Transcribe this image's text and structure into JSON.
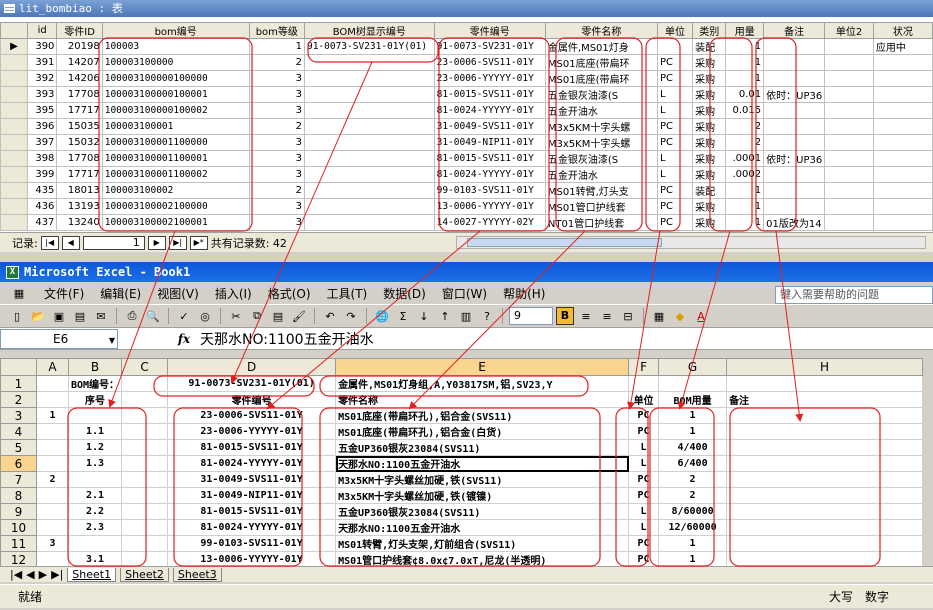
{
  "access": {
    "title": "lit_bombiao : 表",
    "columns": [
      "id",
      "零件ID",
      "bom编号",
      "bom等级",
      "BOM树显示编号",
      "零件编号",
      "零件名称",
      "单位",
      "类别",
      "用量",
      "备注",
      "单位2",
      "状况"
    ],
    "rows": [
      {
        "id": "390",
        "pid": "20198",
        "bom": "100003",
        "level": "1",
        "tree": "91-0073-SV231-01Y(01)",
        "part": "91-0073-SV231-01Y",
        "name": "金属件,MS01灯身",
        "unit": "",
        "cat": "装配",
        "qty": "1",
        "note": "",
        "unit2": "",
        "status": "应用中",
        "current": true
      },
      {
        "id": "391",
        "pid": "14207",
        "bom": "100003100000",
        "level": "2",
        "tree": "",
        "part": "23-0006-SVS11-01Y",
        "name": "MS01底座(带扁环",
        "unit": "PC",
        "cat": "采购",
        "qty": "1",
        "note": "",
        "unit2": "",
        "status": "",
        "current": false
      },
      {
        "id": "392",
        "pid": "14206",
        "bom": "100003100000100000",
        "level": "3",
        "tree": "",
        "part": "23-0006-YYYYY-01Y",
        "name": "MS01底座(带扁环",
        "unit": "PC",
        "cat": "采购",
        "qty": "1",
        "note": "",
        "unit2": "",
        "status": "",
        "current": false
      },
      {
        "id": "393",
        "pid": "17708",
        "bom": "100003100000100001",
        "level": "3",
        "tree": "",
        "part": "81-0015-SVS11-01Y",
        "name": "五金银灰油漆(S",
        "unit": "L",
        "cat": "采购",
        "qty": "0.01",
        "note": "依时：UP36",
        "unit2": "",
        "status": "",
        "current": false
      },
      {
        "id": "395",
        "pid": "17717",
        "bom": "100003100000100002",
        "level": "3",
        "tree": "",
        "part": "81-0024-YYYYY-01Y",
        "name": "五金开油水",
        "unit": "L",
        "cat": "采购",
        "qty": "0.015",
        "note": "",
        "unit2": "",
        "status": "",
        "current": false
      },
      {
        "id": "396",
        "pid": "15035",
        "bom": "100003100001",
        "level": "2",
        "tree": "",
        "part": "31-0049-SVS11-01Y",
        "name": "M3x5KM十字头螺",
        "unit": "PC",
        "cat": "采购",
        "qty": "2",
        "note": "",
        "unit2": "",
        "status": "",
        "current": false
      },
      {
        "id": "397",
        "pid": "15032",
        "bom": "100003100001100000",
        "level": "3",
        "tree": "",
        "part": "31-0049-NIP11-01Y",
        "name": "M3x5KM十字头螺",
        "unit": "PC",
        "cat": "采购",
        "qty": "2",
        "note": "",
        "unit2": "",
        "status": "",
        "current": false
      },
      {
        "id": "398",
        "pid": "17708",
        "bom": "100003100001100001",
        "level": "3",
        "tree": "",
        "part": "81-0015-SVS11-01Y",
        "name": "五金银灰油漆(S",
        "unit": "L",
        "cat": "采购",
        "qty": ".0001",
        "note": "依时：UP36",
        "unit2": "",
        "status": "",
        "current": false
      },
      {
        "id": "399",
        "pid": "17717",
        "bom": "100003100001100002",
        "level": "3",
        "tree": "",
        "part": "81-0024-YYYYY-01Y",
        "name": "五金开油水",
        "unit": "L",
        "cat": "采购",
        "qty": ".0002",
        "note": "",
        "unit2": "",
        "status": "",
        "current": false
      },
      {
        "id": "435",
        "pid": "18013",
        "bom": "100003100002",
        "level": "2",
        "tree": "",
        "part": "99-0103-SVS11-01Y",
        "name": "MS01转臂,灯头支",
        "unit": "PC",
        "cat": "装配",
        "qty": "1",
        "note": "",
        "unit2": "",
        "status": "",
        "current": false
      },
      {
        "id": "436",
        "pid": "13193",
        "bom": "100003100002100000",
        "level": "3",
        "tree": "",
        "part": "13-0006-YYYYY-01Y",
        "name": "MS01管口护线套",
        "unit": "PC",
        "cat": "采购",
        "qty": "1",
        "note": "",
        "unit2": "",
        "status": "",
        "current": false
      },
      {
        "id": "437",
        "pid": "13240",
        "bom": "100003100002100001",
        "level": "3",
        "tree": "",
        "part": "14-0027-YYYYY-02Y",
        "name": "NT01管口护线套",
        "unit": "PC",
        "cat": "采购",
        "qty": "1",
        "note": "01版改为14",
        "unit2": "",
        "status": "",
        "current": false
      }
    ],
    "record_label": "记录:",
    "record_value": "1",
    "record_total": "共有记录数: 42"
  },
  "excel": {
    "title": "Microsoft Excel - Book1",
    "menu": [
      "文件(F)",
      "编辑(E)",
      "视图(V)",
      "插入(I)",
      "格式(O)",
      "工具(T)",
      "数据(D)",
      "窗口(W)",
      "帮助(H)"
    ],
    "help_placeholder": "键入需要帮助的问题",
    "font_size": "9",
    "name_box": "E6",
    "formula": "天那水NO:1100五金开油水",
    "col_headers": [
      "A",
      "B",
      "C",
      "D",
      "E",
      "F",
      "G",
      "H"
    ],
    "rows": [
      {
        "n": "1",
        "a": "",
        "b": "BOM编号：",
        "c": "",
        "d": "91-0073-SV231-01Y(01)",
        "e": "金属件,MS01灯身组,A,Y03817SM,铝,SV23,Y",
        "f": "",
        "g": "",
        "h": ""
      },
      {
        "n": "2",
        "a": "",
        "b": "序号",
        "c": "",
        "d": "零件编号",
        "e": "零件名称",
        "f": "单位",
        "g": "BOM用量",
        "h": "备注"
      },
      {
        "n": "3",
        "a": "1",
        "b": "",
        "c": "",
        "d": "23-0006-SVS11-01Y",
        "e": "MS01底座(带扁环孔),铝合金(SVS11)",
        "f": "PC",
        "g": "1",
        "h": ""
      },
      {
        "n": "4",
        "a": "",
        "b": "1.1",
        "c": "",
        "d": "23-0006-YYYYY-01Y",
        "e": "MS01底座(带扁环孔),铝合金(白货)",
        "f": "PC",
        "g": "1",
        "h": ""
      },
      {
        "n": "5",
        "a": "",
        "b": "1.2",
        "c": "",
        "d": "81-0015-SVS11-01Y",
        "e": "五金UP360银灰23084(SVS11)",
        "f": "L",
        "g": "4/400",
        "h": ""
      },
      {
        "n": "6",
        "a": "",
        "b": "1.3",
        "c": "",
        "d": "81-0024-YYYYY-01Y",
        "e": "天那水NO:1100五金开油水",
        "f": "L",
        "g": "6/400",
        "h": ""
      },
      {
        "n": "7",
        "a": "2",
        "b": "",
        "c": "",
        "d": "31-0049-SVS11-01Y",
        "e": "M3x5KM十字头螺丝加硬,铁(SVS11)",
        "f": "PC",
        "g": "2",
        "h": ""
      },
      {
        "n": "8",
        "a": "",
        "b": "2.1",
        "c": "",
        "d": "31-0049-NIP11-01Y",
        "e": "M3x5KM十字头螺丝加硬,铁(镀镍)",
        "f": "PC",
        "g": "2",
        "h": ""
      },
      {
        "n": "9",
        "a": "",
        "b": "2.2",
        "c": "",
        "d": "81-0015-SVS11-01Y",
        "e": "五金UP360银灰23084(SVS11)",
        "f": "L",
        "g": "8/60000",
        "h": ""
      },
      {
        "n": "10",
        "a": "",
        "b": "2.3",
        "c": "",
        "d": "81-0024-YYYYY-01Y",
        "e": "天那水NO:1100五金开油水",
        "f": "L",
        "g": "12/60000",
        "h": ""
      },
      {
        "n": "11",
        "a": "3",
        "b": "",
        "c": "",
        "d": "99-0103-SVS11-01Y",
        "e": "MS01转臂,灯头支架,灯前组合(SVS11)",
        "f": "PC",
        "g": "1",
        "h": ""
      },
      {
        "n": "12",
        "a": "",
        "b": "3.1",
        "c": "",
        "d": "13-0006-YYYYY-01Y",
        "e": "MS01管口护线套¢8.0x¢7.0xT,尼龙(半透明)",
        "f": "PC",
        "g": "1",
        "h": ""
      }
    ],
    "sheets": [
      "Sheet1",
      "Sheet2",
      "Sheet3"
    ],
    "status_left": "就绪",
    "status_caps": "大写",
    "status_num": "数字"
  },
  "colors": {
    "annotation": "#e02020"
  }
}
